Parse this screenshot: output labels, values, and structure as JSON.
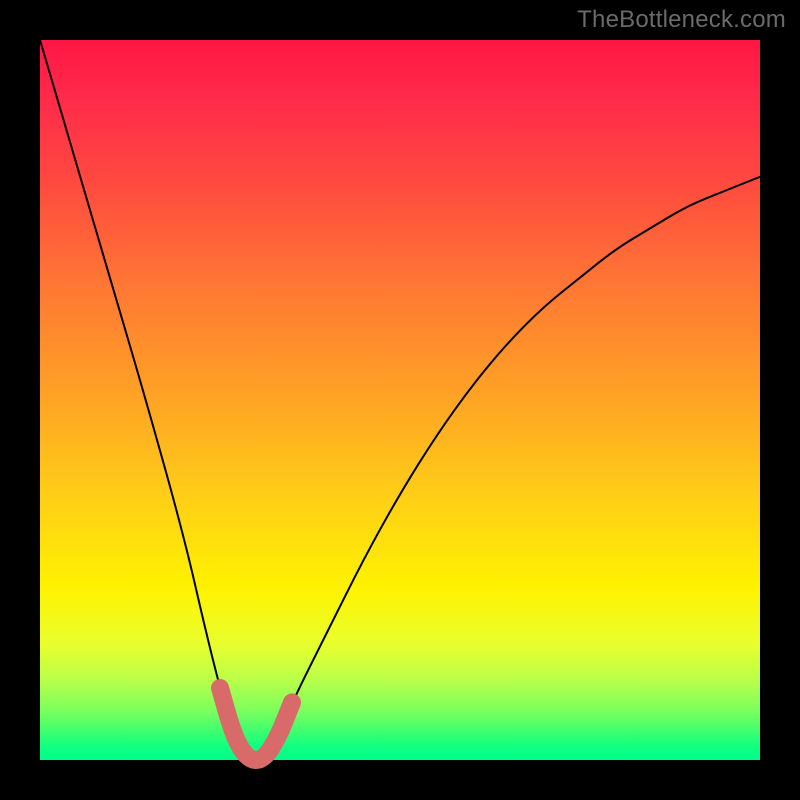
{
  "watermark": "TheBottleneck.com",
  "colors": {
    "frame": "#000000",
    "gradient_top": "#ff1744",
    "gradient_mid": "#ffd016",
    "gradient_bottom": "#00ff88",
    "curve_thin": "#000000",
    "curve_thick": "#d96a6a"
  },
  "chart_data": {
    "type": "line",
    "title": "",
    "xlabel": "",
    "ylabel": "",
    "xlim": [
      0,
      100
    ],
    "ylim": [
      0,
      100
    ],
    "x": [
      0,
      5,
      10,
      15,
      20,
      23,
      25,
      27,
      29,
      31,
      33,
      35,
      40,
      45,
      50,
      55,
      60,
      65,
      70,
      75,
      80,
      85,
      90,
      95,
      100
    ],
    "values": [
      100,
      83,
      66,
      49,
      31,
      18,
      10,
      3,
      0,
      0,
      3,
      8,
      18,
      28,
      37,
      45,
      52,
      58,
      63,
      67,
      71,
      74,
      77,
      79,
      81
    ],
    "series": [
      {
        "name": "curve",
        "x": [
          0,
          5,
          10,
          15,
          20,
          23,
          25,
          27,
          29,
          31,
          33,
          35,
          40,
          45,
          50,
          55,
          60,
          65,
          70,
          75,
          80,
          85,
          90,
          95,
          100
        ],
        "y": [
          100,
          83,
          66,
          49,
          31,
          18,
          10,
          3,
          0,
          0,
          3,
          8,
          18,
          28,
          37,
          45,
          52,
          58,
          63,
          67,
          71,
          74,
          77,
          79,
          81
        ]
      },
      {
        "name": "highlighted_segment",
        "x": [
          25,
          27,
          29,
          31,
          33,
          35
        ],
        "y": [
          10,
          3,
          0,
          0,
          3,
          8
        ]
      }
    ],
    "annotations": []
  }
}
